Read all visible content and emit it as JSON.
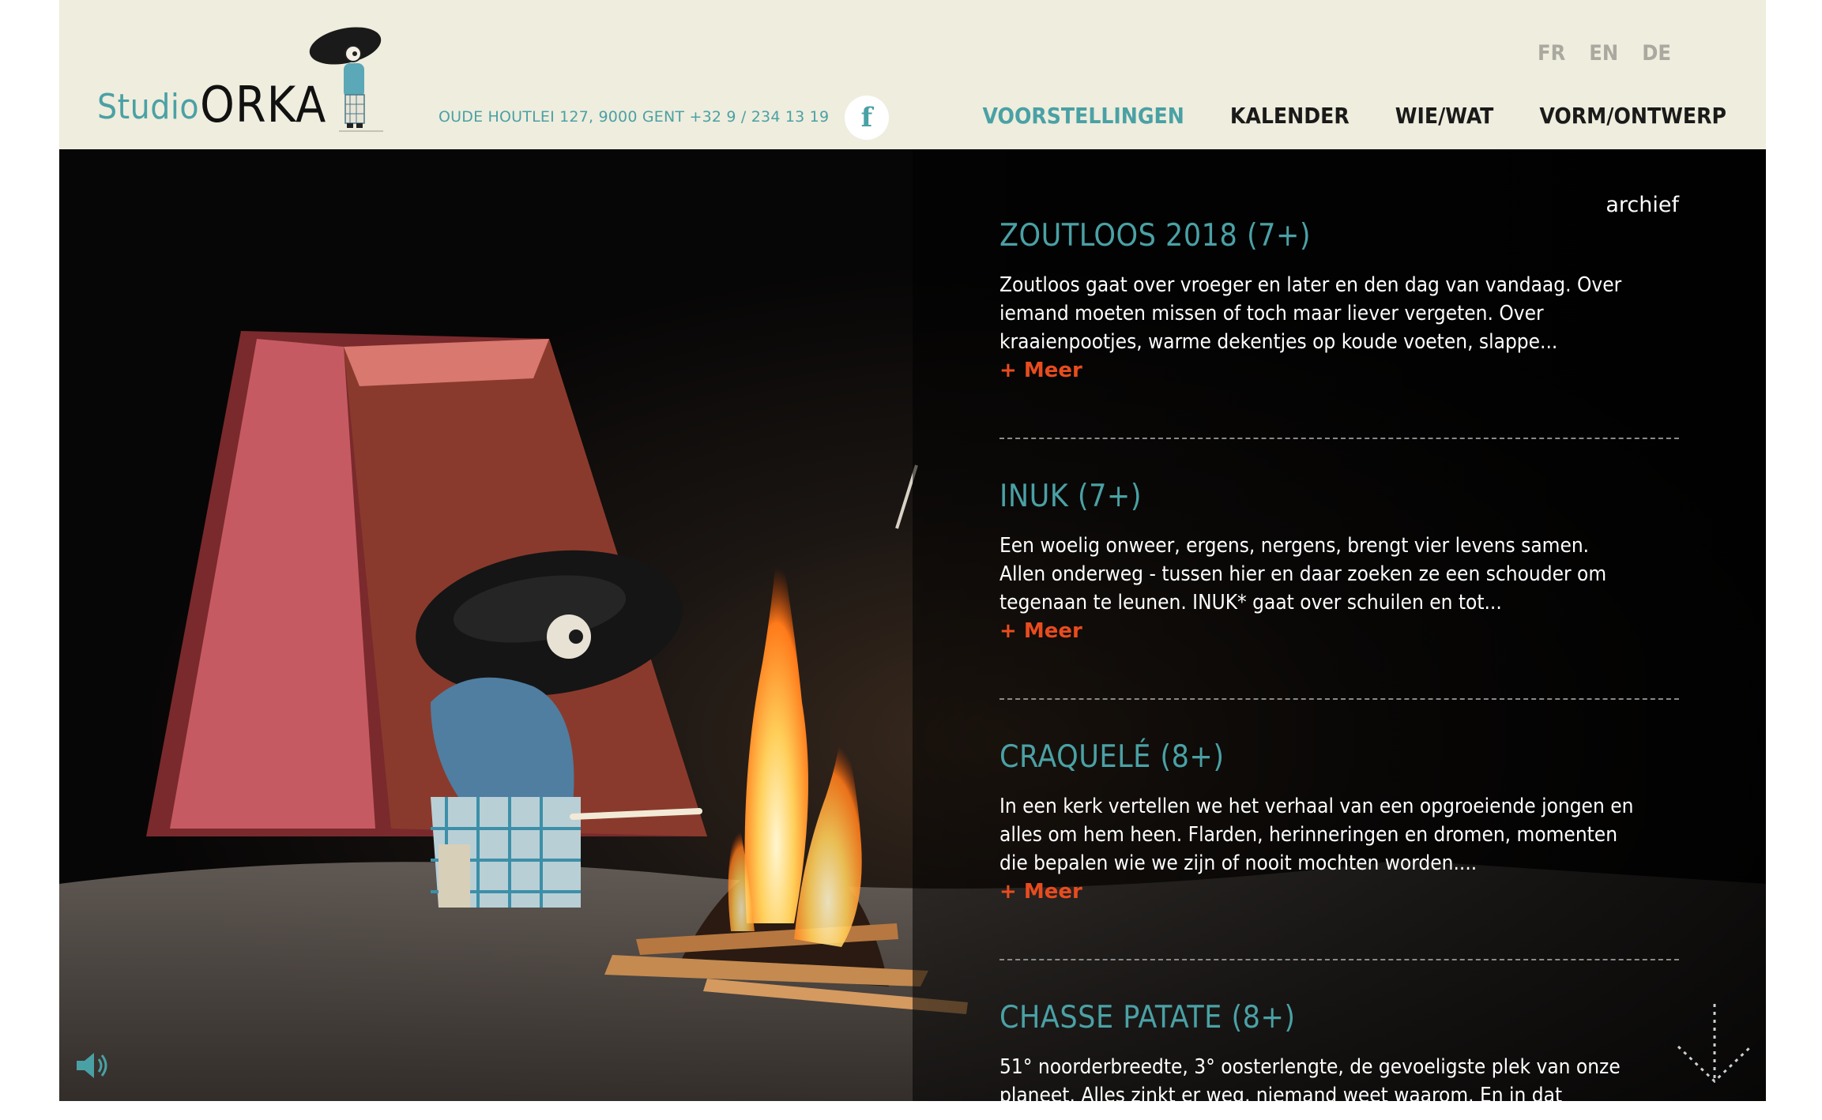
{
  "header": {
    "logo": {
      "studio": "Studio",
      "orka": "ORKA"
    },
    "address": "OUDE HOUTLEI 127, 9000 GENT +32 9 / 234 13 19",
    "facebook_icon": "facebook-icon",
    "languages": [
      "FR",
      "EN",
      "DE"
    ],
    "nav": [
      {
        "label": "VOORSTELLINGEN",
        "active": true
      },
      {
        "label": "KALENDER"
      },
      {
        "label": "WIE/WAT"
      },
      {
        "label": "VORM/ONTWERP"
      }
    ]
  },
  "main": {
    "archive_link": "archief",
    "more_label": "+ Meer",
    "shows": [
      {
        "title": "ZOUTLOOS 2018 (7+)",
        "description": "Zoutloos gaat over vroeger en later en den dag van vandaag. Over iemand moeten missen of toch maar liever vergeten. Over kraaienpootjes, warme dekentjes op koude voeten, slappe..."
      },
      {
        "title": "INUK (7+)",
        "description": "Een woelig onweer, ergens, nergens, brengt vier levens samen. Allen onderweg - tussen hier en daar zoeken ze een schouder om tegenaan te leunen. INUK* gaat over schuilen en tot..."
      },
      {
        "title": "CRAQUELÉ (8+)",
        "description": "In een kerk vertellen we het verhaal van een opgroeiende jongen en alles om hem heen. Flarden, herinneringen en dromen, momenten die bepalen wie we zijn of nooit mochten worden...."
      },
      {
        "title": "CHASSE PATATE (8+)",
        "description": "51° noorderbreedte, 3° oosterlengte, de gevoeligste plek van onze planeet. Alles zinkt er weg, niemand weet waarom. En in dat"
      }
    ]
  },
  "colors": {
    "accent": "#4aa1a5",
    "more": "#e84c1e",
    "header_bg": "#efeddd"
  },
  "icons": {
    "sound": "speaker-icon",
    "scroll": "arrow-down-icon"
  }
}
